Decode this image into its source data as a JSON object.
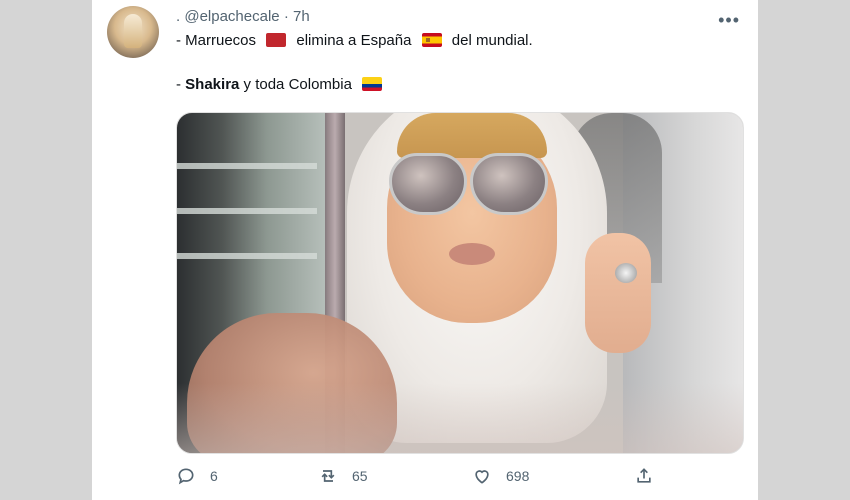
{
  "tweet": {
    "display_name": ".",
    "handle": "@elpachecale",
    "time": "7h",
    "line1": {
      "part1": "- Marruecos",
      "part2": "elimina a España",
      "part3": "del mundial."
    },
    "line2": {
      "dash": "- ",
      "bold_name": "Shakira",
      "rest": " y toda Colombia"
    },
    "flags": [
      "morocco-flag-icon",
      "spain-flag-icon",
      "colombia-flag-icon"
    ],
    "media": {
      "type": "photo"
    },
    "actions": {
      "reply_count": "6",
      "retweet_count": "65",
      "like_count": "698",
      "share_label": ""
    }
  },
  "colors": {
    "text": "#0f1419",
    "secondary": "#536471",
    "background": "#ffffff"
  }
}
